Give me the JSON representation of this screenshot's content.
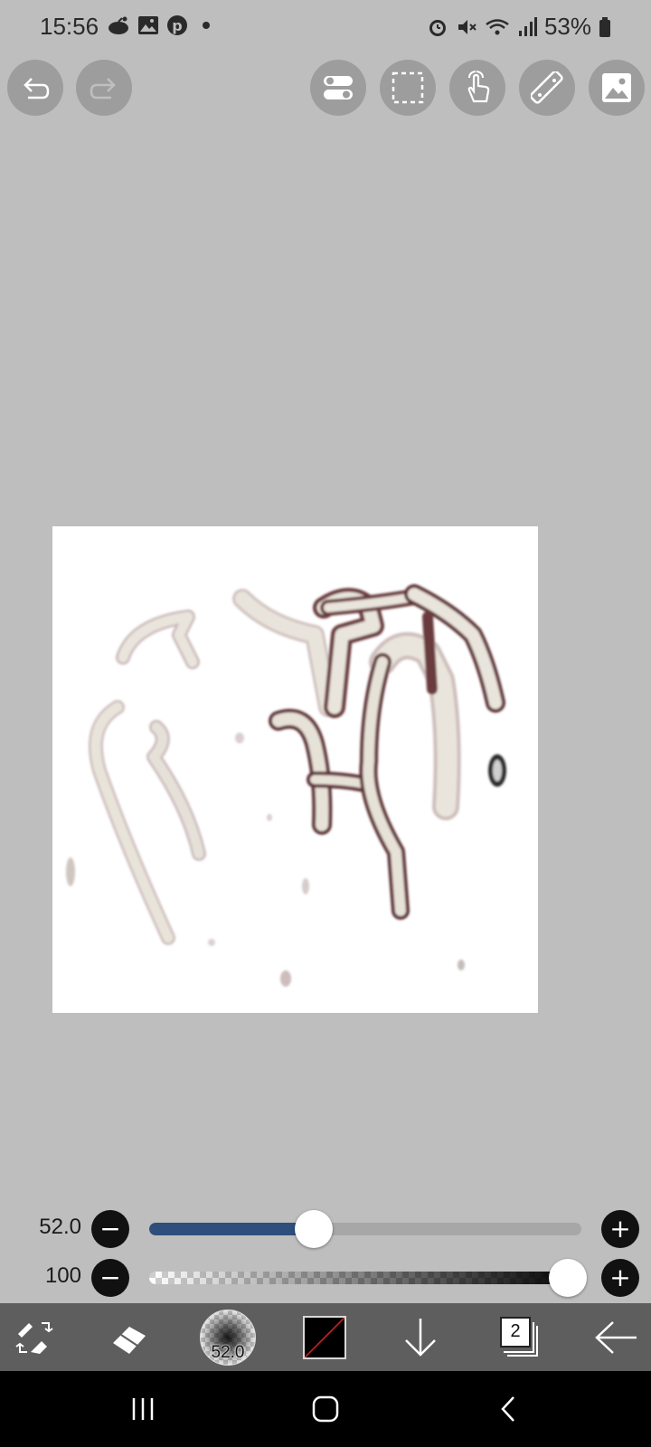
{
  "status_bar": {
    "time": "15:56",
    "battery": "53%",
    "left_icons": [
      "reddit-icon",
      "gallery-icon",
      "pinterest-icon",
      "dot-icon"
    ],
    "right_icons": [
      "alarm-icon",
      "mute-icon",
      "wifi-icon",
      "signal-icon",
      "battery-icon"
    ]
  },
  "toolbar": {
    "left": [
      "undo",
      "redo"
    ],
    "right": [
      "toggle-settings",
      "selection",
      "hand-gesture",
      "ruler",
      "image-reference"
    ]
  },
  "sliders": {
    "size": {
      "value": "52.0",
      "fraction": 0.38
    },
    "opacity": {
      "value": "100",
      "fraction": 1.0
    },
    "minus": "−",
    "plus": "+"
  },
  "bottom_bar": {
    "brush_size": "52.0",
    "layers_count": "2",
    "color": "#000000"
  },
  "colors": {
    "background": "#bebebe",
    "accent": "#2e4e7c",
    "bottom_bar": "#5e5e5e"
  }
}
